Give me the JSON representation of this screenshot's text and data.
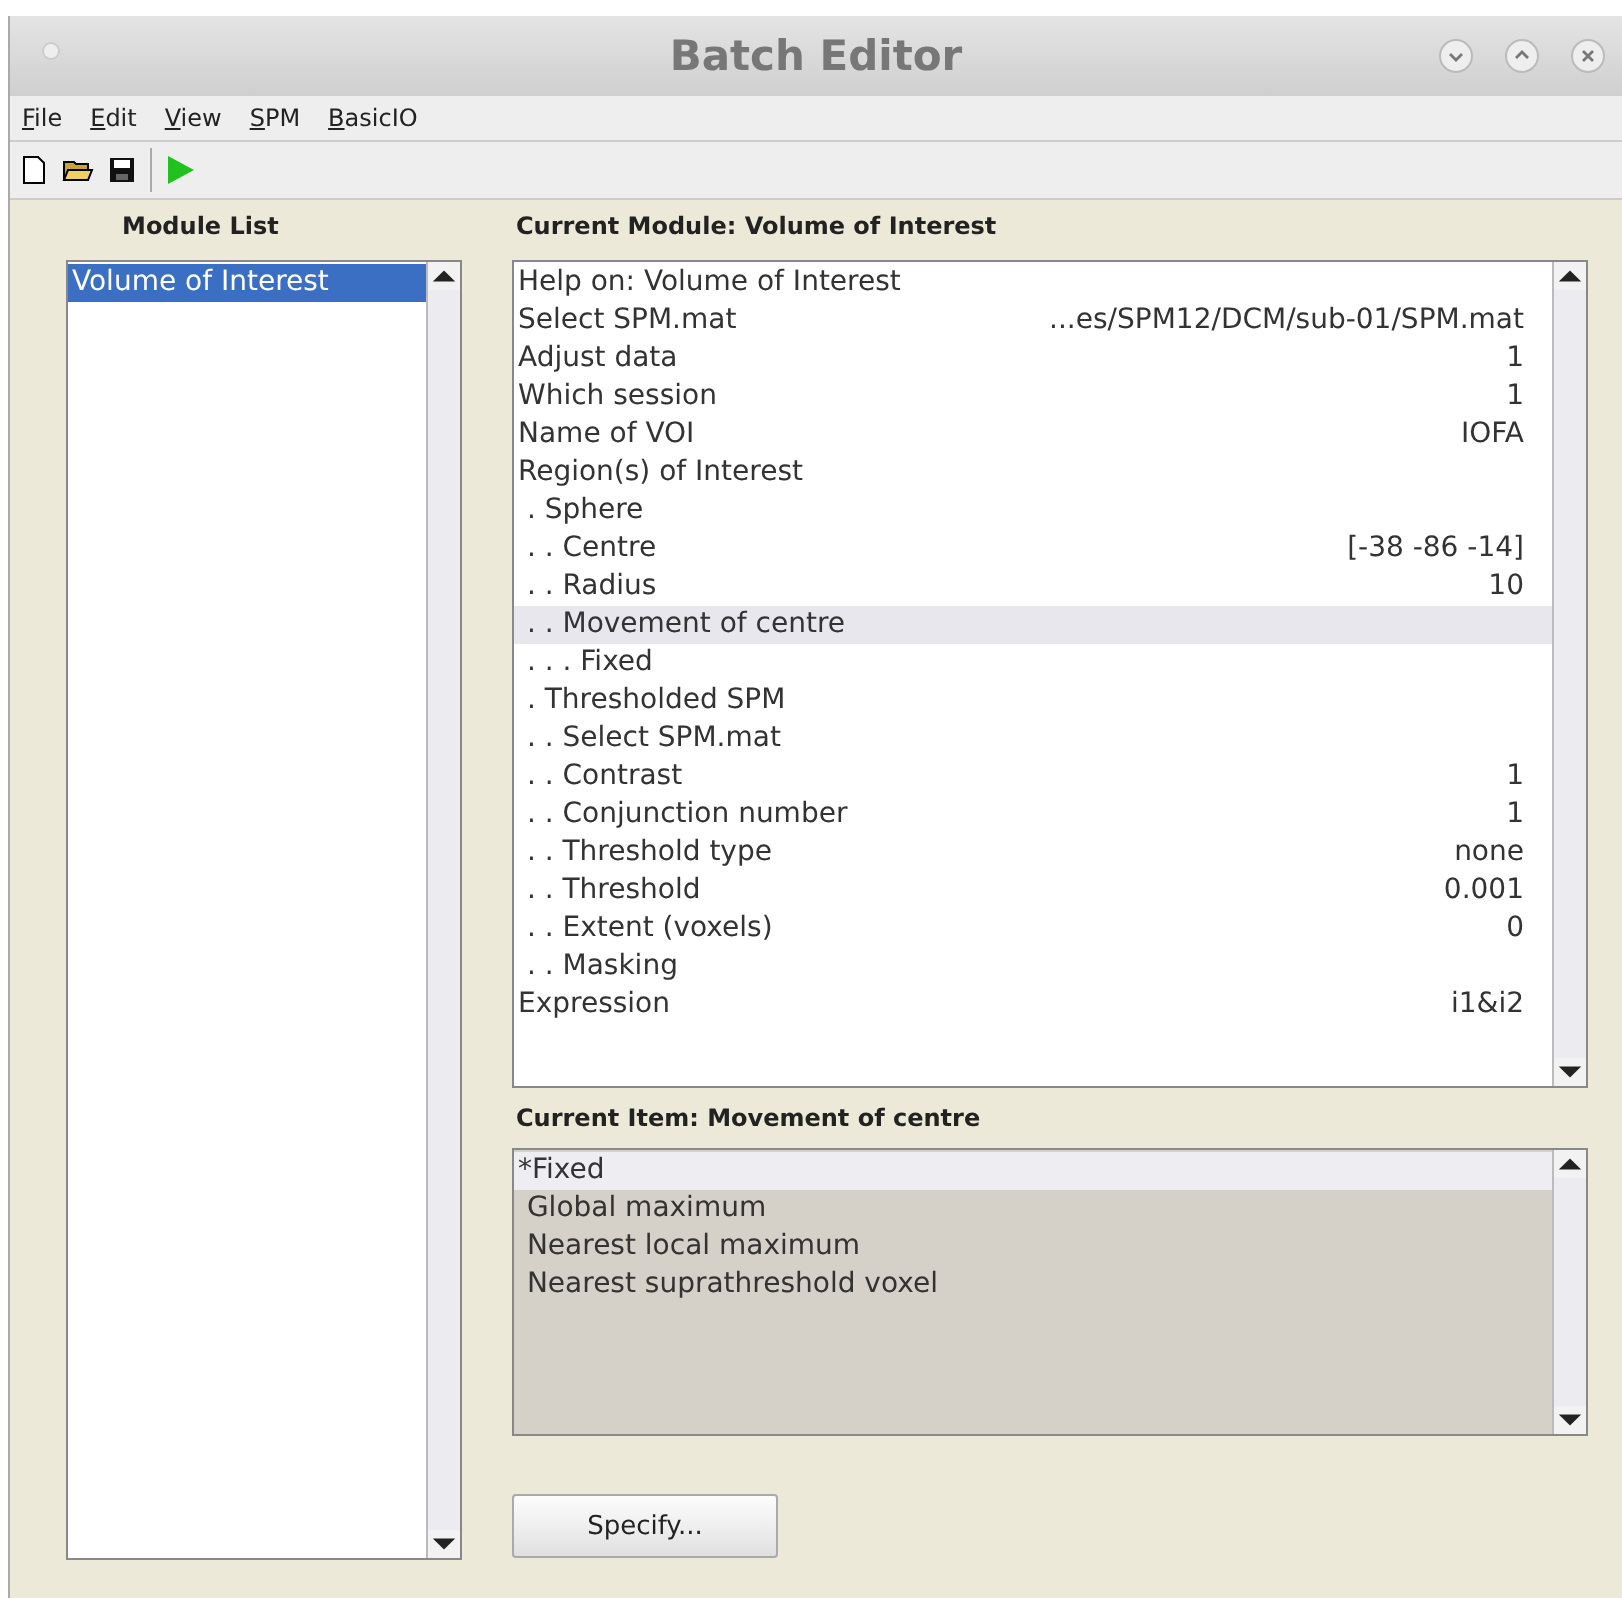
{
  "window": {
    "title": "Batch Editor"
  },
  "menu": [
    "File",
    "Edit",
    "View",
    "SPM",
    "BasicIO"
  ],
  "module_list": {
    "heading": "Module List",
    "items": [
      {
        "label": "Volume of Interest",
        "selected": true
      }
    ]
  },
  "current_module": {
    "heading": "Current Module: Volume of Interest",
    "rows": [
      {
        "label": "Help on: Volume of Interest",
        "value": "",
        "selected": false
      },
      {
        "label": "Select SPM.mat",
        "value": "...es/SPM12/DCM/sub-01/SPM.mat",
        "selected": false
      },
      {
        "label": "Adjust data",
        "value": "1",
        "selected": false
      },
      {
        "label": "Which session",
        "value": "1",
        "selected": false
      },
      {
        "label": "Name of VOI",
        "value": "IOFA",
        "selected": false
      },
      {
        "label": "Region(s) of Interest",
        "value": "",
        "selected": false
      },
      {
        "label": " . Sphere",
        "value": "",
        "selected": false
      },
      {
        "label": " . . Centre",
        "value": "[-38 -86 -14]",
        "selected": false
      },
      {
        "label": " . . Radius",
        "value": "10",
        "selected": false
      },
      {
        "label": " . . Movement of centre",
        "value": "",
        "selected": true
      },
      {
        "label": " . . . Fixed",
        "value": "",
        "selected": false
      },
      {
        "label": " . Thresholded SPM",
        "value": "",
        "selected": false
      },
      {
        "label": " . . Select SPM.mat",
        "value": "",
        "selected": false
      },
      {
        "label": " . . Contrast",
        "value": "1",
        "selected": false
      },
      {
        "label": " . . Conjunction number",
        "value": "1",
        "selected": false
      },
      {
        "label": " . . Threshold type",
        "value": "none",
        "selected": false
      },
      {
        "label": " . . Threshold",
        "value": "0.001",
        "selected": false
      },
      {
        "label": " . . Extent (voxels)",
        "value": "0",
        "selected": false
      },
      {
        "label": " . . Masking",
        "value": "",
        "selected": false
      },
      {
        "label": "Expression",
        "value": "i1&i2",
        "selected": false
      }
    ]
  },
  "current_item": {
    "heading": "Current Item: Movement of centre",
    "options": [
      {
        "label": "*Fixed",
        "selected": true
      },
      {
        "label": " Global maximum",
        "selected": false
      },
      {
        "label": " Nearest local maximum",
        "selected": false
      },
      {
        "label": " Nearest suprathreshold voxel",
        "selected": false
      }
    ]
  },
  "buttons": [
    "Specify..."
  ]
}
